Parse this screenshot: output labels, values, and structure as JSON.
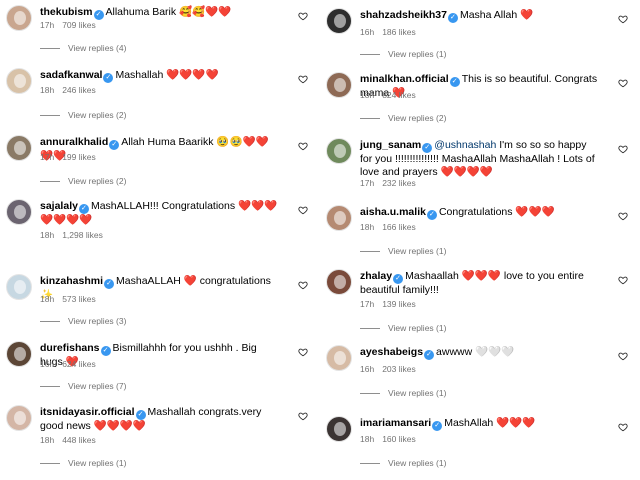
{
  "left": [
    {
      "user": "thekubism",
      "text": "Allahuma Barik 🥰🥰❤️❤️",
      "time": "17h",
      "likes": "709 likes",
      "replies": "View replies (4)",
      "avatar": "#c9a68f"
    },
    {
      "user": "sadafkanwal",
      "text": "Mashallah ❤️❤️❤️❤️",
      "time": "18h",
      "likes": "246 likes",
      "replies": "View replies (2)",
      "avatar": "#d8c2a8"
    },
    {
      "user": "annuralkhalid",
      "text": "Allah Huma Baarikk 🥹🥹❤️❤️❤️❤️",
      "time": "17h",
      "likes": "199 likes",
      "replies": "View replies (2)",
      "avatar": "#8a7a66"
    },
    {
      "user": "sajalaly",
      "text": "MashALLAH!!! Congratulations ❤️❤️❤️❤️❤️❤️❤️",
      "time": "18h",
      "likes": "1,298 likes",
      "replies": "",
      "avatar": "#6b6470"
    },
    {
      "user": "kinzahashmi",
      "text": "MashaALLAH ❤️ congratulations ✨",
      "time": "18h",
      "likes": "573 likes",
      "replies": "View replies (3)",
      "avatar": "#c7d8e2"
    },
    {
      "user": "durefishans",
      "text": "Bismillahhh for you ushhh . Big hugs ❤️",
      "time": "16h",
      "likes": "624 likes",
      "replies": "View replies (7)",
      "avatar": "#5c4636"
    },
    {
      "user": "itsnidayasir.official",
      "text": "Mashallah congrats.very good news ❤️❤️❤️❤️",
      "time": "18h",
      "likes": "448 likes",
      "replies": "View replies (1)",
      "avatar": "#d4b6a6"
    }
  ],
  "right": [
    {
      "user": "shahzadsheikh37",
      "text": "Masha Allah ❤️",
      "time": "16h",
      "likes": "186 likes",
      "replies": "View replies (1)",
      "avatar": "#2e2e2e"
    },
    {
      "user": "minalkhan.official",
      "text": "This is so beautiful. Congrats mama ❤️",
      "time": "18h",
      "likes": "824 likes",
      "replies": "View replies (2)",
      "avatar": "#8e6a55"
    },
    {
      "user": "jung_sanam",
      "mention": "@ushnashah",
      "text": "I'm so so so happy for you !!!!!!!!!!!!!!! MashaAllah MashaAllah ! Lots of love and prayers ❤️❤️❤️❤️",
      "time": "17h",
      "likes": "232 likes",
      "replies": "",
      "avatar": "#6f8a5c"
    },
    {
      "user": "aisha.u.malik",
      "text": "Congratulations ❤️❤️❤️",
      "time": "18h",
      "likes": "166 likes",
      "replies": "View replies (1)",
      "avatar": "#b58a72"
    },
    {
      "user": "zhalay",
      "text": "Mashaallah ❤️❤️❤️ love to you entire beautiful family!!!",
      "time": "17h",
      "likes": "139 likes",
      "replies": "View replies (1)",
      "avatar": "#7a4a3a"
    },
    {
      "user": "ayeshabeigs",
      "text": "awwww 🤍🤍🤍",
      "time": "16h",
      "likes": "203 likes",
      "replies": "View replies (1)",
      "avatar": "#d6bba5"
    },
    {
      "user": "imariamansari",
      "text": "MashAllah ❤️❤️❤️",
      "time": "18h",
      "likes": "160 likes",
      "replies": "View replies (1)",
      "avatar": "#3b3433"
    }
  ]
}
